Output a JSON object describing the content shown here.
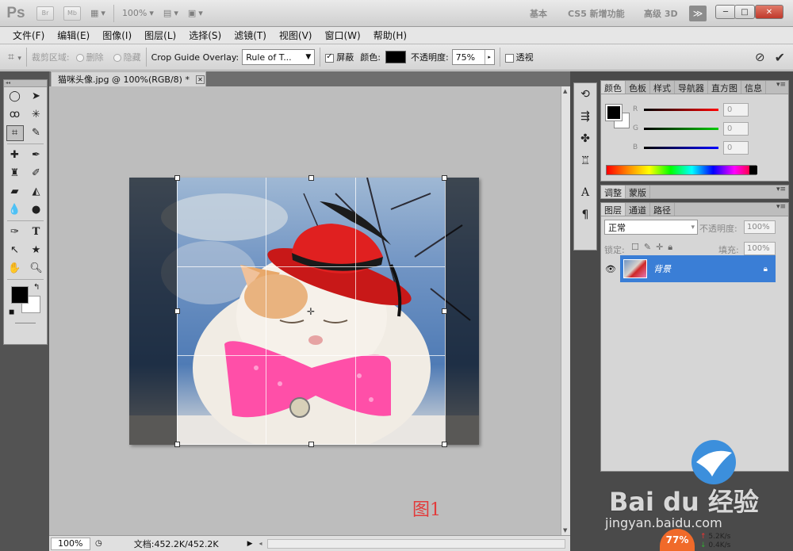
{
  "app": {
    "logo": "Ps",
    "bridge": "Br",
    "minibridge": "Mb",
    "zoom": "100%",
    "workspaces": [
      "基本",
      "CS5 新增功能",
      "高级 3D"
    ],
    "workspaces_more": "≫",
    "window_controls": [
      "─",
      "□",
      "✕"
    ]
  },
  "menu": [
    "文件(F)",
    "编辑(E)",
    "图像(I)",
    "图层(L)",
    "选择(S)",
    "滤镜(T)",
    "视图(V)",
    "窗口(W)",
    "帮助(H)"
  ],
  "options": {
    "crop_area_label": "裁剪区域:",
    "delete_label": "删除",
    "hide_label": "隐藏",
    "overlay_label": "Crop Guide Overlay:",
    "overlay_value": "Rule of T...",
    "shield_label": "屏蔽",
    "color_label": "颜色:",
    "opacity_label": "不透明度:",
    "opacity_value": "75%",
    "perspective_label": "透视",
    "colors": {
      "shield_color": "#000000"
    }
  },
  "document": {
    "tab_title": "猫咪头像.jpg @ 100%(RGB/8) *",
    "status_zoom": "100%",
    "doc_size": "文档:452.2K/452.2K",
    "figure_label": "图1"
  },
  "panels": {
    "color_tabs": [
      "颜色",
      "色板",
      "样式",
      "导航器",
      "直方图",
      "信息"
    ],
    "channels": [
      {
        "label": "R",
        "value": "0"
      },
      {
        "label": "G",
        "value": "0"
      },
      {
        "label": "B",
        "value": "0"
      }
    ],
    "adjust_tabs": [
      "调整",
      "蒙版"
    ],
    "layer_tabs": [
      "图层",
      "通道",
      "路径"
    ],
    "blend_mode": "正常",
    "layer_opacity_label": "不透明度:",
    "layer_opacity_value": "100%",
    "lock_label": "锁定:",
    "fill_label": "填充:",
    "fill_value": "100%",
    "layer_name": "背景"
  },
  "watermark": {
    "logo_text": "Bai du 经验",
    "url": "jingyan.baidu.com",
    "badge": "77%",
    "up_speed": "5.2K/s",
    "down_speed": "0.4K/s"
  }
}
